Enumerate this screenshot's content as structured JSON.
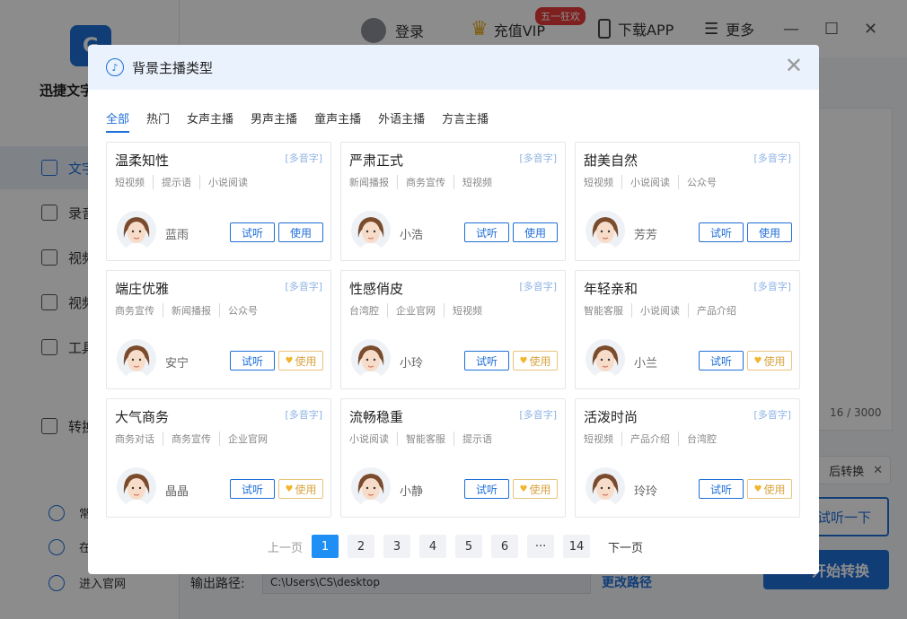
{
  "app": {
    "name": "迅捷文字转语音",
    "nav": [
      {
        "label": "文字转语音"
      },
      {
        "label": "录音转文字"
      },
      {
        "label": "视频转文字"
      },
      {
        "label": "视频配音"
      },
      {
        "label": "工具箱"
      },
      {
        "label": "转换列表"
      }
    ],
    "footer": [
      {
        "label": "常见问题"
      },
      {
        "label": "在线客服"
      },
      {
        "label": "进入官网"
      }
    ]
  },
  "topbar": {
    "login": "登录",
    "vip": "充值VIP",
    "promo": "五一狂欢",
    "download": "下载APP",
    "more": "更多",
    "minimize": "—",
    "maximize": "☐",
    "close": "✕"
  },
  "main": {
    "counter": "16 / 3000",
    "convert_tip": "后转换",
    "convert_tip_close": "✕",
    "listen_label": "试听一下",
    "start_label": "开始转换",
    "output_label": "输出路径:",
    "output_path": "C:\\Users\\CS\\desktop",
    "change_path": "更改路径"
  },
  "modal": {
    "title": "背景主播类型",
    "close": "✕",
    "tabs": [
      {
        "label": "全部",
        "active": true
      },
      {
        "label": "热门"
      },
      {
        "label": "女声主播"
      },
      {
        "label": "男声主播"
      },
      {
        "label": "童声主播"
      },
      {
        "label": "外语主播"
      },
      {
        "label": "方言主播"
      }
    ],
    "cards": [
      {
        "title": "温柔知性",
        "badge": "[多音字]",
        "tags": [
          "短视频",
          "提示语",
          "小说阅读"
        ],
        "name": "蓝雨",
        "try": "试听",
        "use": "使用",
        "vip": false
      },
      {
        "title": "严肃正式",
        "badge": "[多音字]",
        "tags": [
          "新闻播报",
          "商务宣传",
          "短视频"
        ],
        "name": "小浩",
        "try": "试听",
        "use": "使用",
        "vip": false
      },
      {
        "title": "甜美自然",
        "badge": "[多音字]",
        "tags": [
          "短视频",
          "小说阅读",
          "公众号"
        ],
        "name": "芳芳",
        "try": "试听",
        "use": "使用",
        "vip": false
      },
      {
        "title": "端庄优雅",
        "badge": "[多音字]",
        "tags": [
          "商务宣传",
          "新闻播报",
          "公众号"
        ],
        "name": "安宁",
        "try": "试听",
        "use": "使用",
        "vip": true
      },
      {
        "title": "性感俏皮",
        "badge": "[多音字]",
        "tags": [
          "台湾腔",
          "企业官网",
          "短视频"
        ],
        "name": "小玲",
        "try": "试听",
        "use": "使用",
        "vip": true
      },
      {
        "title": "年轻亲和",
        "badge": "[多音字]",
        "tags": [
          "智能客服",
          "小说阅读",
          "产品介绍"
        ],
        "name": "小兰",
        "try": "试听",
        "use": "使用",
        "vip": true
      },
      {
        "title": "大气商务",
        "badge": "[多音字]",
        "tags": [
          "商务对话",
          "商务宣传",
          "企业官网"
        ],
        "name": "晶晶",
        "try": "试听",
        "use": "使用",
        "vip": true
      },
      {
        "title": "流畅稳重",
        "badge": "[多音字]",
        "tags": [
          "小说阅读",
          "智能客服",
          "提示语"
        ],
        "name": "小静",
        "try": "试听",
        "use": "使用",
        "vip": true
      },
      {
        "title": "活泼时尚",
        "badge": "[多音字]",
        "tags": [
          "短视频",
          "产品介绍",
          "台湾腔"
        ],
        "name": "玲玲",
        "try": "试听",
        "use": "使用",
        "vip": true
      }
    ],
    "pagination": {
      "prev": "上一页",
      "pages": [
        "1",
        "2",
        "3",
        "4",
        "5",
        "6",
        "···",
        "14"
      ],
      "current": "1",
      "next": "下一页"
    }
  },
  "colors": {
    "accent": "#1f6fd9",
    "page_active": "#1f8ff5",
    "vip_gold": "#d9a441",
    "header_bg": "#e9f2fd"
  }
}
